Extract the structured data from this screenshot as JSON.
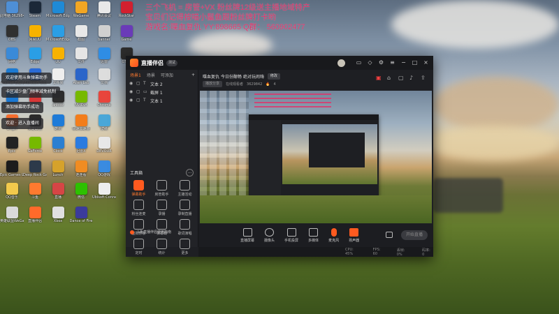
{
  "headline": {
    "line1": "三个飞机 = 房管+VX 粉丝牌12级送主播地域特产",
    "line2": "宝贝们记得按喵小鬣鱼跟粉丝牌打卡哟",
    "line3": "游戏名:喋血复仇 YY:898665 Q群： 560902477"
  },
  "desktop_icons": [
    {
      "label": "此电脑\n3629842",
      "color": "#4e8fd6"
    },
    {
      "label": "Steam",
      "color": "#1b2838"
    },
    {
      "label": "Microsoft Edge",
      "color": "#1f8ad6"
    },
    {
      "label": "WeGame",
      "color": "#f2a623"
    },
    {
      "label": "腾讯会议",
      "color": "#e8e8e8"
    },
    {
      "label": "RockStar",
      "color": "#d2202f"
    },
    {
      "label": "OBS",
      "color": "#303030"
    },
    {
      "label": "网易UU",
      "color": "#f7b200"
    },
    {
      "label": "MicrosoftEdge",
      "color": "#2a9ee5"
    },
    {
      "label": "截图",
      "color": "#e8e8e8"
    },
    {
      "label": "banner",
      "color": "#d0d0d0"
    },
    {
      "label": "Game",
      "color": "#6a3bb8"
    },
    {
      "label": "网络",
      "color": "#3a8ad8"
    },
    {
      "label": "Edge",
      "color": "#2a9ee5"
    },
    {
      "label": "UU",
      "color": "#f7b200"
    },
    {
      "label": "文件",
      "color": "#e5e5e5"
    },
    {
      "label": "迅雷",
      "color": "#2f8de4"
    },
    {
      "label": "GTAV",
      "color": "#2d2d2d"
    },
    {
      "label": "Internet Explorer",
      "color": "#1b7ad2"
    },
    {
      "label": "Microsoft Store",
      "color": "#2a6ad6"
    },
    {
      "label": "文件夹",
      "color": "#eee"
    },
    {
      "label": "Alien Lab",
      "color": "#2b65c9"
    },
    {
      "label": "文档",
      "color": "#ddd"
    },
    {
      "label": "Battle.net",
      "color": "#1a78d2"
    },
    {
      "label": "Taptap",
      "color": "#d83737"
    },
    {
      "label": "anbsw",
      "color": "#2d2d2d"
    },
    {
      "label": "NVIDIA",
      "color": "#77b900"
    },
    {
      "label": "Chrome",
      "color": "#e8453c"
    },
    {
      "label": "Origin",
      "color": "#f56c2d"
    },
    {
      "label": "英雄联盟",
      "color": "#2a2a2a"
    },
    {
      "label": "酷狗",
      "color": "#1e7bd8"
    },
    {
      "label": "极速加速器",
      "color": "#f37d1b"
    },
    {
      "label": "壁纸",
      "color": "#4aa7d8"
    },
    {
      "label": "Epic",
      "color": "#222"
    },
    {
      "label": "GeForce",
      "color": "#76b900"
    },
    {
      "label": "Clock",
      "color": "#2b7fd1"
    },
    {
      "label": "迅雷X",
      "color": "#2a7be0"
    },
    {
      "label": "DEVOUR",
      "color": "#e8e8e8"
    },
    {
      "label": "Epic Games Launcher",
      "color": "#1c1c1c"
    },
    {
      "label": "Deep Rock Galactic",
      "color": "#2d3a4a"
    },
    {
      "label": "Lunch",
      "color": "#d6a22b"
    },
    {
      "label": "连连看",
      "color": "#f08c22"
    },
    {
      "label": "QQ游戏",
      "color": "#3a8be0"
    },
    {
      "label": "QQ音乐",
      "color": "#f2c94c"
    },
    {
      "label": "斗鱼",
      "color": "#ff7a2f"
    },
    {
      "label": "直播",
      "color": "#d64545"
    },
    {
      "label": "微信",
      "color": "#2dc100"
    },
    {
      "label": "Ubisoft Connect",
      "color": "#eee"
    },
    {
      "label": "英雄联盟WeGame版",
      "color": "#d9d9d9"
    },
    {
      "label": "直播伴侣",
      "color": "#ff6a2a"
    },
    {
      "label": "Xbox",
      "color": "#e0e0e0"
    },
    {
      "label": "Dance of Fire",
      "color": "#3b3b9b"
    }
  ],
  "toasts": [
    "欢迎使用斗鱼弹幕助手",
    "卡区减少盘门频率减免机制",
    "添加弹幕助手成功",
    "欢迎 · 进入直播间"
  ],
  "app": {
    "title": "直播伴侣",
    "beta": "测试",
    "tabs": [
      "场景1",
      "场景",
      "可添加"
    ],
    "sources": [
      "文本 2",
      "截屏 1",
      "文本 1"
    ],
    "tools_title": "工具箱",
    "tools": [
      {
        "label": "弹幕助手",
        "active": true
      },
      {
        "label": "房管助手",
        "active": false
      },
      {
        "label": "主播活动",
        "active": false
      },
      {
        "label": "粉丝连麦",
        "active": false
      },
      {
        "label": "录播",
        "active": false
      },
      {
        "label": "录制直播",
        "active": false
      },
      {
        "label": "虚拟形象",
        "active": false
      },
      {
        "label": "弹幕截",
        "active": false
      },
      {
        "label": "歌词演唱",
        "active": false
      },
      {
        "label": "定时",
        "active": false
      },
      {
        "label": "统计",
        "active": false
      },
      {
        "label": "更多",
        "active": false
      }
    ],
    "notice": "斗鱼直播伴侣使用指南",
    "stage": {
      "title": "喋血复仇 今日份酣畅 绝对玩闹嗨",
      "edit_btn": "修改",
      "sub": [
        "播放分享",
        "在线观看者",
        "3629842",
        "4"
      ]
    },
    "bottom_actions": [
      "直播屏幕",
      "摄像头",
      "手机投屏",
      "多媒体",
      "麦克风",
      "扬声器"
    ],
    "start_label": "开始直播",
    "status_items": [
      "CPU: 45%",
      "FPS: 60",
      "丢帧: 0%",
      "码率: 0"
    ]
  }
}
